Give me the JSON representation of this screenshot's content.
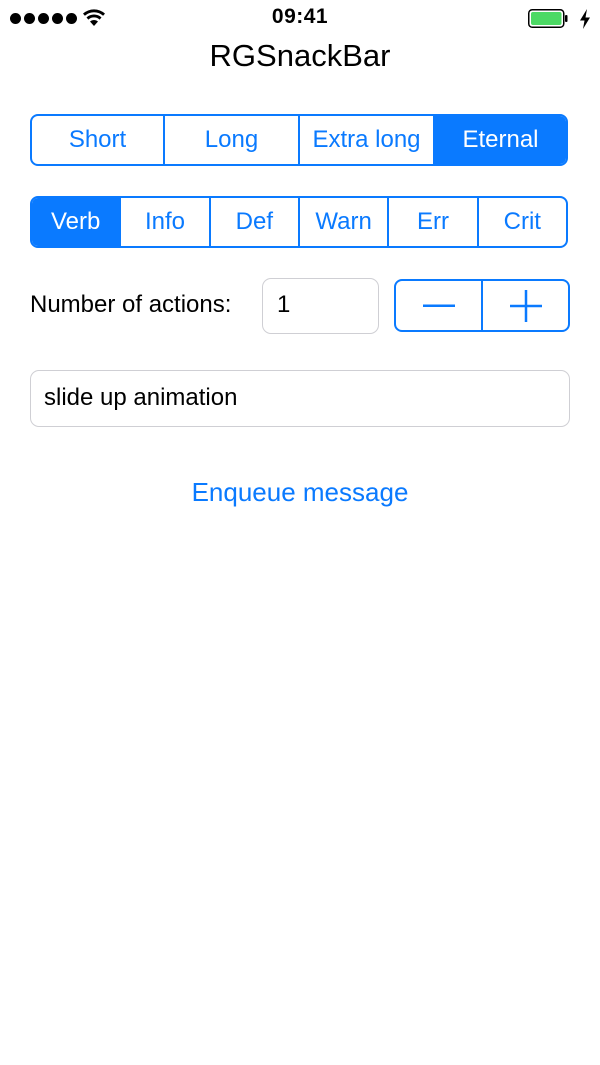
{
  "status_bar": {
    "time": "09:41",
    "signal_icon": "signal-dots-icon",
    "wifi_icon": "wifi-icon",
    "battery_icon": "battery-icon",
    "charging_icon": "charging-bolt-icon"
  },
  "nav": {
    "title": "RGSnackBar"
  },
  "duration": {
    "options": [
      "Short",
      "Long",
      "Extra long",
      "Eternal"
    ],
    "selected": "Eternal"
  },
  "level": {
    "options": [
      "Verb",
      "Info",
      "Def",
      "Warn",
      "Err",
      "Crit"
    ],
    "selected": "Verb"
  },
  "actions": {
    "label": "Number of actions:",
    "value": "1",
    "decrement_icon": "minus-icon",
    "increment_icon": "plus-icon"
  },
  "animation": {
    "value": "slide up animation"
  },
  "enqueue": {
    "label": "Enqueue message"
  },
  "colors": {
    "accent": "#0a7aff",
    "battery_fill": "#4cd964",
    "field_border": "#cfcfd4"
  }
}
